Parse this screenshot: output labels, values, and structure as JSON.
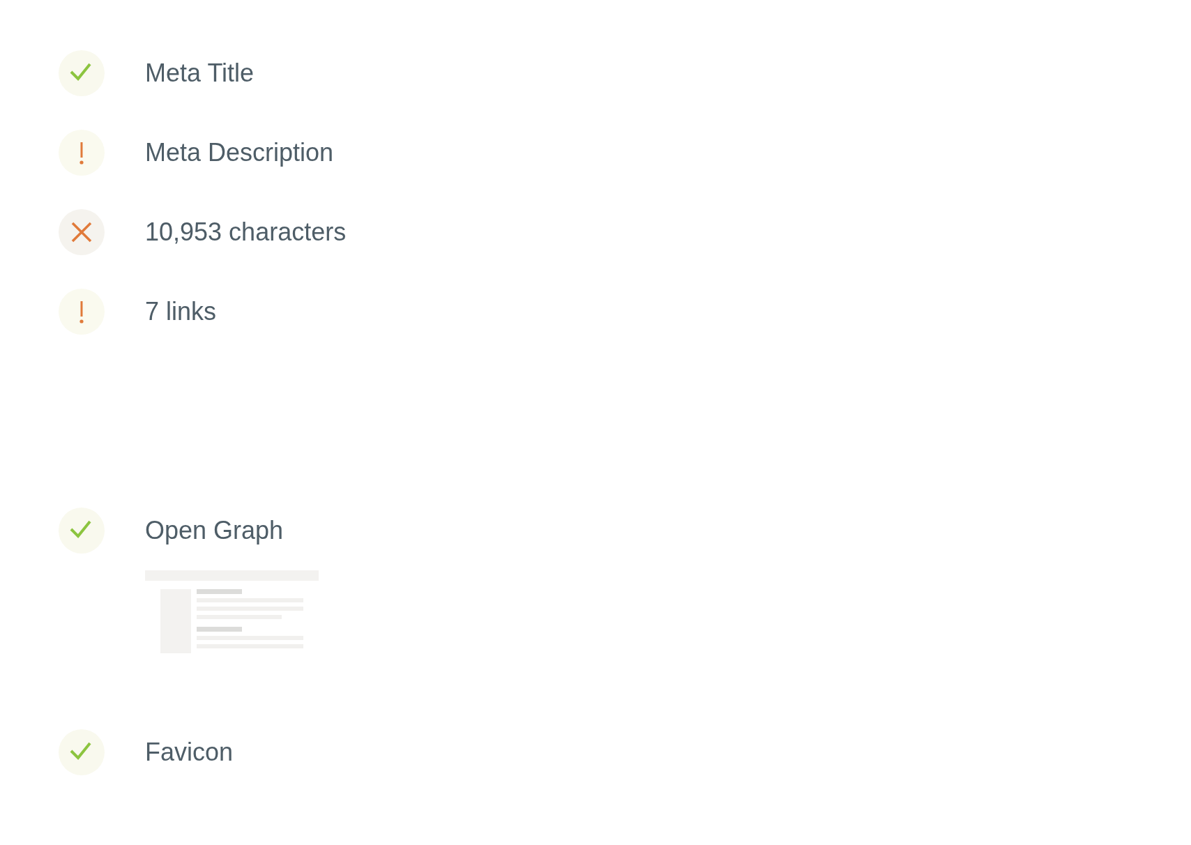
{
  "sections": [
    {
      "items": [
        {
          "label": "Meta Title",
          "kind": "pass",
          "preview": false
        },
        {
          "label": "Meta Description",
          "kind": "warning",
          "preview": false
        },
        {
          "label": "10,953 characters",
          "kind": "fail",
          "preview": false
        },
        {
          "label": "7 links",
          "kind": "warning",
          "preview": false
        }
      ]
    },
    {
      "items": [
        {
          "label": "Open Graph",
          "kind": "pass",
          "preview": true
        },
        {
          "label": "Favicon",
          "kind": "pass",
          "preview": false
        }
      ]
    }
  ]
}
